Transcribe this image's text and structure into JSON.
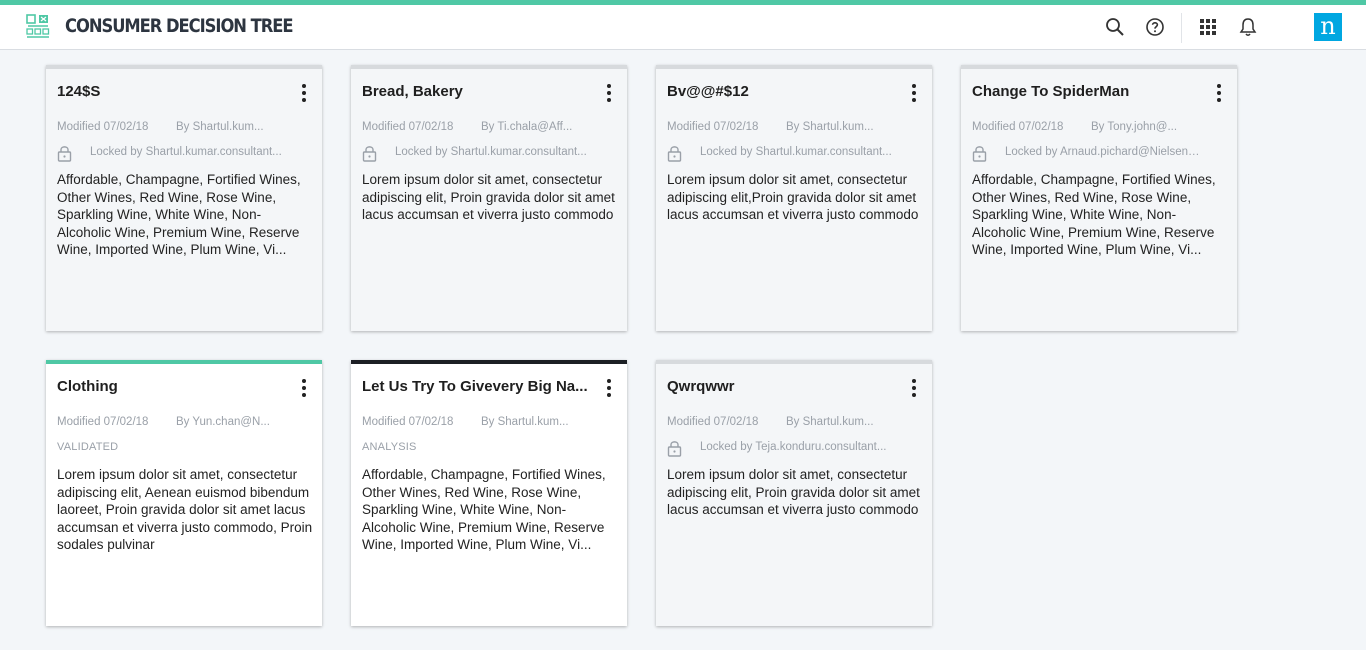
{
  "header": {
    "app_title": "CONSUMER DECISION TREE",
    "brand_letter": "n",
    "icons": [
      "search-icon",
      "help-icon",
      "apps-grid-icon",
      "bell-icon"
    ],
    "colors": {
      "accent": "#4fc8a5",
      "brand": "#00a7e1"
    }
  },
  "cards": [
    {
      "title": "124$S",
      "modified": "Modified 07/02/18",
      "author": "By Shartul.kum...",
      "lock": "Locked by Shartul.kumar.consultant...",
      "status": "",
      "description": "Affordable, Champagne, Fortified Wines, Other Wines, Red Wine, Rose Wine, Sparkling Wine, White Wine, Non-Alcoholic Wine, Premium Wine, Reserve Wine, Imported Wine, Plum Wine, Vi..."
    },
    {
      "title": "Bread, Bakery",
      "modified": "Modified 07/02/18",
      "author": "By Ti.chala@Aff...",
      "lock": "Locked by Shartul.kumar.consultant...",
      "status": "",
      "description": "Lorem ipsum dolor sit amet, consectetur adipiscing elit, Proin gravida dolor sit amet lacus accumsan et viverra justo commodo"
    },
    {
      "title": "Bv@@#$12",
      "modified": "Modified 07/02/18",
      "author": "By Shartul.kum...",
      "lock": "Locked by Shartul.kumar.consultant...",
      "status": "",
      "description": "Lorem ipsum dolor sit amet, consectetur adipiscing elit,Proin gravida dolor sit amet lacus accumsan et viverra justo commodo"
    },
    {
      "title": "Change To SpiderMan",
      "modified": "Modified 07/02/18",
      "author": "By Tony.john@...",
      "lock": "Locked by Arnaud.pichard@Nielsen....",
      "status": "",
      "description": "Affordable, Champagne, Fortified Wines, Other Wines, Red Wine, Rose Wine, Sparkling Wine, White Wine, Non-Alcoholic Wine, Premium Wine, Reserve Wine, Imported Wine, Plum Wine, Vi..."
    },
    {
      "title": "Clothing",
      "modified": "Modified 07/02/18",
      "author": "By Yun.chan@N...",
      "lock": "",
      "status": "VALIDATED",
      "description": "Lorem ipsum dolor sit amet, consectetur adipiscing elit, Aenean euismod bibendum laoreet, Proin gravida dolor sit amet lacus accumsan et viverra justo commodo, Proin sodales pulvinar"
    },
    {
      "title": "Let Us Try To Givevery Big Na...",
      "modified": "Modified 07/02/18",
      "author": "By Shartul.kum...",
      "lock": "",
      "status": "ANALYSIS",
      "description": "Affordable, Champagne, Fortified Wines, Other Wines, Red Wine, Rose Wine, Sparkling Wine, White Wine, Non-Alcoholic Wine, Premium Wine, Reserve Wine, Imported Wine, Plum Wine, Vi..."
    },
    {
      "title": "Qwrqwwr",
      "modified": "Modified 07/02/18",
      "author": "By Shartul.kum...",
      "lock": "Locked by Teja.konduru.consultant...",
      "status": "",
      "description": "Lorem ipsum dolor sit amet, consectetur adipiscing elit, Proin gravida dolor sit amet lacus accumsan et viverra justo commodo"
    }
  ]
}
